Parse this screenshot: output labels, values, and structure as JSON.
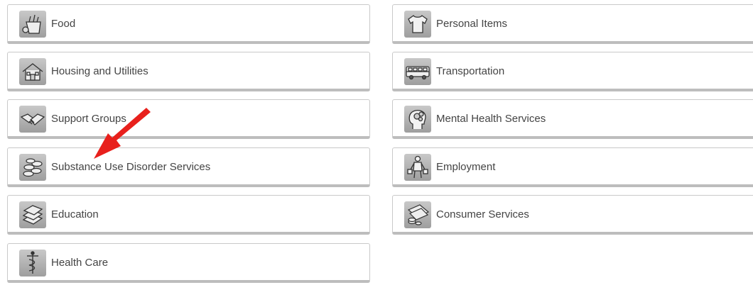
{
  "categories": {
    "left": [
      {
        "label": "Food",
        "icon": "grocery-bag-icon"
      },
      {
        "label": "Housing and Utilities",
        "icon": "house-icon"
      },
      {
        "label": "Support Groups",
        "icon": "handshake-icon"
      },
      {
        "label": "Substance Use Disorder Services",
        "icon": "pills-icon"
      },
      {
        "label": "Education",
        "icon": "books-icon"
      },
      {
        "label": "Health Care",
        "icon": "caduceus-icon"
      }
    ],
    "right": [
      {
        "label": "Personal Items",
        "icon": "tshirt-icon"
      },
      {
        "label": "Transportation",
        "icon": "bus-icon"
      },
      {
        "label": "Mental Health Services",
        "icon": "head-gears-icon"
      },
      {
        "label": "Employment",
        "icon": "worker-icon"
      },
      {
        "label": "Consumer Services",
        "icon": "money-icon"
      }
    ]
  },
  "colors": {
    "card_border": "#c9c9c9",
    "card_shadow": "#bdbdbd",
    "label_text": "#444444",
    "icon_bg": "#b0b0b0",
    "arrow": "#e8201c"
  }
}
